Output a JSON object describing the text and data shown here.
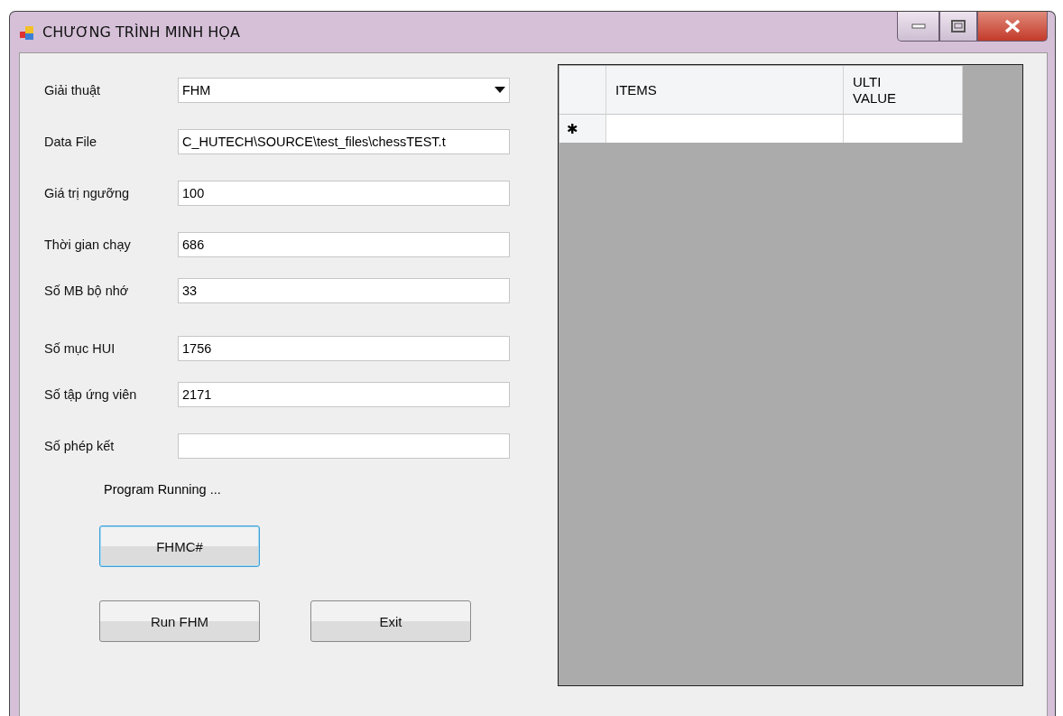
{
  "window": {
    "title": "CHƯƠNG TRÌNH MINH HỌA"
  },
  "fields": [
    {
      "kind": "dropdown",
      "label": "Giải thuật",
      "value": "FHM"
    },
    {
      "kind": "text",
      "label": "Data File",
      "value": "C_HUTECH\\SOURCE\\test_files\\chessTEST.t"
    },
    {
      "kind": "text",
      "label": "Giá trị ngưỡng",
      "value": "100"
    },
    {
      "kind": "text",
      "label": "Thời gian chạy",
      "value": "686"
    },
    {
      "kind": "text",
      "label": "Số MB bộ nhớ",
      "value": "33"
    },
    {
      "kind": "text",
      "label": "Số mục HUI",
      "value": "1756"
    },
    {
      "kind": "text",
      "label": "Số tập ứng viên",
      "value": "2171"
    },
    {
      "kind": "text",
      "label": "Số phép kết"
    }
  ],
  "status": "Program Running ...",
  "buttons": [
    {
      "label": "FHMC#",
      "focused": true
    },
    {
      "label": "Run FHM",
      "focused": false
    },
    {
      "label": "Exit",
      "focused": false
    }
  ],
  "table": {
    "columns": [
      "ITEMS",
      "ULTI\nVALUE"
    ],
    "new_row_marker": "✱"
  }
}
